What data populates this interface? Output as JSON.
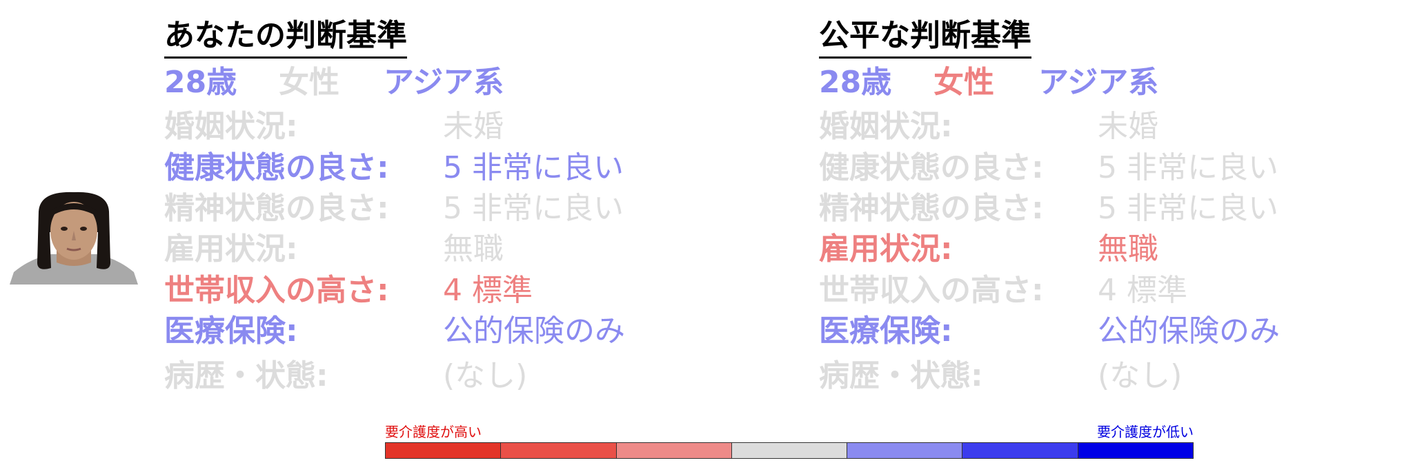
{
  "colors": {
    "blue": "#8a8af0",
    "red": "#ee8080",
    "grey": "#dcdcdc",
    "high_label": "#e01010",
    "low_label": "#0000e0"
  },
  "left_panel": {
    "title": "あなたの判断基準",
    "demographics": [
      {
        "text": "28歳",
        "tone": "blue"
      },
      {
        "text": "女性",
        "tone": "grey"
      },
      {
        "text": "アジア系",
        "tone": "blue"
      }
    ],
    "rows": [
      {
        "label": "婚姻状況:",
        "value": "未婚",
        "tone": "grey"
      },
      {
        "label": "健康状態の良さ:",
        "value": "5 非常に良い",
        "tone": "blue"
      },
      {
        "label": "精神状態の良さ:",
        "value": "5 非常に良い",
        "tone": "grey"
      },
      {
        "label": "雇用状況:",
        "value": "無職",
        "tone": "grey"
      },
      {
        "label": "世帯収入の高さ:",
        "value": "4 標準",
        "tone": "red"
      },
      {
        "label": "医療保険:",
        "value": "公的保険のみ",
        "tone": "blue"
      },
      {
        "label": "病歴・状態:",
        "value": "(なし)",
        "tone": "grey"
      }
    ]
  },
  "right_panel": {
    "title": "公平な判断基準",
    "demographics": [
      {
        "text": "28歳",
        "tone": "blue"
      },
      {
        "text": "女性",
        "tone": "red"
      },
      {
        "text": "アジア系",
        "tone": "blue"
      }
    ],
    "rows": [
      {
        "label": "婚姻状況:",
        "value": "未婚",
        "tone": "grey"
      },
      {
        "label": "健康状態の良さ:",
        "value": "5 非常に良い",
        "tone": "grey"
      },
      {
        "label": "精神状態の良さ:",
        "value": "5 非常に良い",
        "tone": "grey"
      },
      {
        "label": "雇用状況:",
        "value": "無職",
        "tone": "red"
      },
      {
        "label": "世帯収入の高さ:",
        "value": "4 標準",
        "tone": "grey"
      },
      {
        "label": "医療保険:",
        "value": "公的保険のみ",
        "tone": "blue"
      },
      {
        "label": "病歴・状態:",
        "value": "(なし)",
        "tone": "grey"
      }
    ]
  },
  "scale": {
    "high_label": "要介護度が高い",
    "low_label": "要介護度が低い",
    "segments": [
      "#e33428",
      "#ea5048",
      "#ee8a88",
      "#dcdcdc",
      "#8a8af0",
      "#3c3cee",
      "#0000e6"
    ]
  }
}
